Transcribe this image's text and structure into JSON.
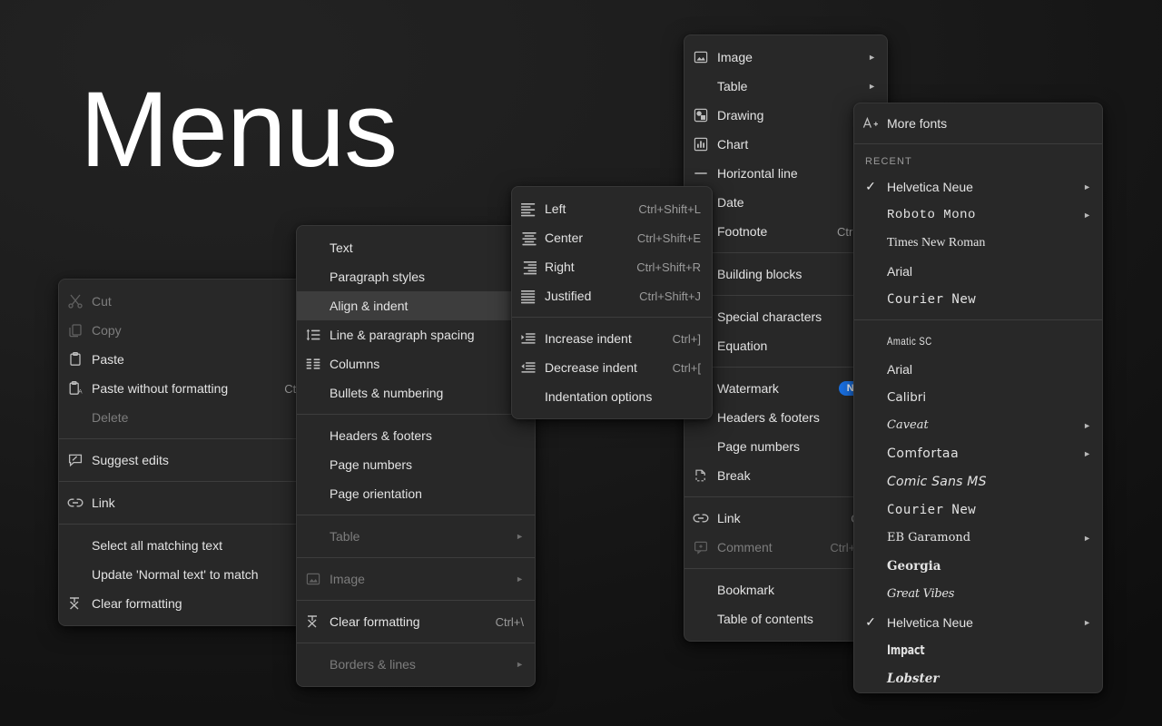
{
  "page": {
    "title": "Menus",
    "background": "#1a1a1a",
    "accent": "#1a73e8"
  },
  "context_menu": {
    "items": [
      {
        "label": "Cut",
        "shortcut": "",
        "icon": "scissors-icon",
        "disabled": true
      },
      {
        "label": "Copy",
        "shortcut": "",
        "icon": "copy-icon",
        "disabled": true
      },
      {
        "label": "Paste",
        "shortcut": "",
        "icon": "clipboard-icon",
        "disabled": false
      },
      {
        "label": "Paste without formatting",
        "shortcut": "Ctrl+",
        "icon": "clipboard-text-icon",
        "disabled": false
      },
      {
        "label": "Delete",
        "shortcut": "",
        "icon": "",
        "disabled": true
      },
      {
        "separator": true
      },
      {
        "label": "Suggest edits",
        "shortcut": "",
        "icon": "suggest-edits-icon",
        "disabled": false
      },
      {
        "separator": true
      },
      {
        "label": "Link",
        "shortcut": "",
        "icon": "link-icon",
        "disabled": false
      },
      {
        "separator": true
      },
      {
        "label": "Select all matching text",
        "shortcut": "",
        "icon": "",
        "disabled": false
      },
      {
        "label": "Update 'Normal text' to match",
        "shortcut": "",
        "icon": "",
        "disabled": false
      },
      {
        "label": "Clear formatting",
        "shortcut": "",
        "icon": "clear-formatting-icon",
        "disabled": false
      }
    ]
  },
  "format_menu": {
    "items": [
      {
        "label": "Text",
        "icon": "",
        "arrow": false,
        "disabled": false,
        "highlight": false
      },
      {
        "label": "Paragraph styles",
        "icon": "",
        "arrow": false,
        "disabled": false,
        "highlight": false
      },
      {
        "label": "Align & indent",
        "icon": "",
        "arrow": false,
        "disabled": false,
        "highlight": true
      },
      {
        "label": "Line & paragraph spacing",
        "icon": "line-spacing-icon",
        "arrow": false,
        "disabled": false,
        "highlight": false
      },
      {
        "label": "Columns",
        "icon": "columns-icon",
        "arrow": false,
        "disabled": false,
        "highlight": false
      },
      {
        "label": "Bullets & numbering",
        "icon": "",
        "arrow": false,
        "disabled": false,
        "highlight": false
      },
      {
        "separator": true
      },
      {
        "label": "Headers & footers",
        "icon": "",
        "arrow": false,
        "disabled": false,
        "highlight": false
      },
      {
        "label": "Page numbers",
        "icon": "",
        "arrow": false,
        "disabled": false,
        "highlight": false
      },
      {
        "label": "Page orientation",
        "icon": "",
        "arrow": false,
        "disabled": false,
        "highlight": false
      },
      {
        "separator": true
      },
      {
        "label": "Table",
        "icon": "",
        "arrow": true,
        "disabled": true,
        "highlight": false
      },
      {
        "separator": true
      },
      {
        "label": "Image",
        "icon": "image-icon",
        "arrow": true,
        "disabled": true,
        "highlight": false
      },
      {
        "separator": true
      },
      {
        "label": "Clear formatting",
        "icon": "clear-formatting-icon",
        "arrow": false,
        "disabled": false,
        "highlight": false,
        "shortcut": "Ctrl+\\"
      },
      {
        "separator": true
      },
      {
        "label": "Borders & lines",
        "icon": "",
        "arrow": true,
        "disabled": true,
        "highlight": false
      }
    ]
  },
  "align_menu": {
    "items": [
      {
        "label": "Left",
        "shortcut": "Ctrl+Shift+L",
        "icon": "align-left-icon"
      },
      {
        "label": "Center",
        "shortcut": "Ctrl+Shift+E",
        "icon": "align-center-icon"
      },
      {
        "label": "Right",
        "shortcut": "Ctrl+Shift+R",
        "icon": "align-right-icon"
      },
      {
        "label": "Justified",
        "shortcut": "Ctrl+Shift+J",
        "icon": "align-justify-icon"
      },
      {
        "separator": true
      },
      {
        "label": "Increase indent",
        "shortcut": "Ctrl+]",
        "icon": "indent-increase-icon"
      },
      {
        "label": "Decrease indent",
        "shortcut": "Ctrl+[",
        "icon": "indent-decrease-icon"
      },
      {
        "label": "Indentation options",
        "shortcut": "",
        "icon": ""
      }
    ]
  },
  "insert_menu": {
    "items": [
      {
        "label": "Image",
        "shortcut": "",
        "icon": "image-icon",
        "arrow": true,
        "disabled": false
      },
      {
        "label": "Table",
        "shortcut": "",
        "icon": "",
        "arrow": true,
        "disabled": false
      },
      {
        "label": "Drawing",
        "shortcut": "",
        "icon": "drawing-icon",
        "arrow": false,
        "disabled": false
      },
      {
        "label": "Chart",
        "shortcut": "",
        "icon": "chart-icon",
        "arrow": false,
        "disabled": false
      },
      {
        "label": "Horizontal line",
        "shortcut": "",
        "icon": "horizontal-line-icon",
        "arrow": false,
        "disabled": false
      },
      {
        "label": "Date",
        "shortcut": "",
        "icon": "",
        "arrow": false,
        "disabled": false
      },
      {
        "label": "Footnote",
        "shortcut": "Ctrl+Alt",
        "icon": "",
        "arrow": false,
        "disabled": false
      },
      {
        "separator": true
      },
      {
        "label": "Building blocks",
        "shortcut": "",
        "icon": "",
        "arrow": false,
        "disabled": false
      },
      {
        "separator": true
      },
      {
        "label": "Special characters",
        "shortcut": "",
        "icon": "",
        "arrow": false,
        "disabled": false
      },
      {
        "label": "Equation",
        "shortcut": "",
        "icon": "",
        "arrow": false,
        "disabled": false
      },
      {
        "separator": true
      },
      {
        "label": "Watermark",
        "shortcut": "",
        "icon": "",
        "arrow": false,
        "disabled": false,
        "badge": "New"
      },
      {
        "label": "Headers & footers",
        "shortcut": "",
        "icon": "",
        "arrow": false,
        "disabled": false
      },
      {
        "label": "Page numbers",
        "shortcut": "",
        "icon": "",
        "arrow": false,
        "disabled": false
      },
      {
        "label": "Break",
        "shortcut": "",
        "icon": "break-icon",
        "arrow": false,
        "disabled": false
      },
      {
        "separator": true
      },
      {
        "label": "Link",
        "shortcut": "Ctrl+",
        "icon": "link-icon",
        "arrow": false,
        "disabled": false
      },
      {
        "label": "Comment",
        "shortcut": "Ctrl+Alt+",
        "icon": "comment-icon",
        "arrow": false,
        "disabled": true
      },
      {
        "separator": true
      },
      {
        "label": "Bookmark",
        "shortcut": "",
        "icon": "",
        "arrow": false,
        "disabled": false
      },
      {
        "label": "Table of contents",
        "shortcut": "",
        "icon": "",
        "arrow": false,
        "disabled": false
      }
    ]
  },
  "fonts_menu": {
    "more_fonts_label": "More fonts",
    "more_fonts_icon": "add-font-icon",
    "recent_header": "RECENT",
    "recent": [
      {
        "label": "Helvetica Neue",
        "checked": true,
        "arrow": true,
        "style": "f-helv"
      },
      {
        "label": "Roboto Mono",
        "checked": false,
        "arrow": true,
        "style": "f-mono"
      },
      {
        "label": "Times New Roman",
        "checked": false,
        "arrow": false,
        "style": "f-serif"
      },
      {
        "label": "Arial",
        "checked": false,
        "arrow": false,
        "style": "f-arial"
      },
      {
        "label": "Courier New",
        "checked": false,
        "arrow": false,
        "style": "f-courier"
      }
    ],
    "all": [
      {
        "label": "Amatic SC",
        "checked": false,
        "arrow": false,
        "style": "f-amatic"
      },
      {
        "label": "Arial",
        "checked": false,
        "arrow": false,
        "style": "f-arial"
      },
      {
        "label": "Calibri",
        "checked": false,
        "arrow": false,
        "style": "f-calibri"
      },
      {
        "label": "Caveat",
        "checked": false,
        "arrow": true,
        "style": "f-caveat"
      },
      {
        "label": "Comfortaa",
        "checked": false,
        "arrow": true,
        "style": "f-comfort"
      },
      {
        "label": "Comic Sans MS",
        "checked": false,
        "arrow": false,
        "style": "f-comic"
      },
      {
        "label": "Courier New",
        "checked": false,
        "arrow": false,
        "style": "f-courier"
      },
      {
        "label": "EB Garamond",
        "checked": false,
        "arrow": true,
        "style": "f-garamond"
      },
      {
        "label": "Georgia",
        "checked": false,
        "arrow": false,
        "style": "f-georgia"
      },
      {
        "label": "Great Vibes",
        "checked": false,
        "arrow": false,
        "style": "f-vibes"
      },
      {
        "label": "Helvetica Neue",
        "checked": true,
        "arrow": true,
        "style": "f-helv"
      },
      {
        "label": "Impact",
        "checked": false,
        "arrow": false,
        "style": "f-impact"
      },
      {
        "label": "Lobster",
        "checked": false,
        "arrow": false,
        "style": "f-lobster"
      }
    ]
  }
}
